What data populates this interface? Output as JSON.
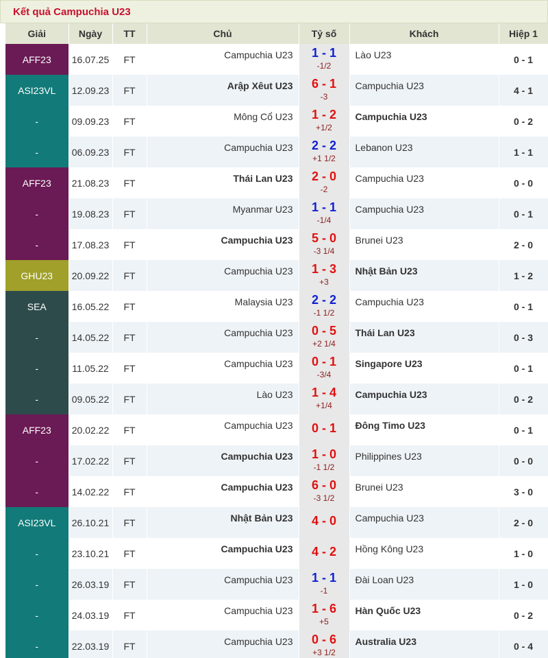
{
  "page": {
    "title": "Kết quả Campuchia U23"
  },
  "colors": {
    "title": "#c8102e",
    "home_win": "#e01010",
    "draw": "#1020d0"
  },
  "table": {
    "headers": {
      "league": "Giải",
      "date": "Ngày",
      "status": "TT",
      "home": "Chủ",
      "score": "Tỷ số",
      "away": "Khách",
      "ht": "Hiệp 1"
    },
    "rows": [
      {
        "league": "AFF23",
        "league_color": "#6a1a54",
        "date": "16.07.25",
        "status": "FT",
        "home": "Campuchia U23",
        "score": "1 - 1",
        "score_color": "blue",
        "handicap": "-1/2",
        "away": "Lào U23",
        "ht": "0 - 1",
        "winner": ""
      },
      {
        "league": "ASI23VL",
        "league_color": "#127a78",
        "date": "12.09.23",
        "status": "FT",
        "home": "Arập Xêut U23",
        "score": "6 - 1",
        "score_color": "red",
        "handicap": "-3",
        "away": "Campuchia U23",
        "ht": "4 - 1",
        "winner": "home"
      },
      {
        "league": "-",
        "league_color": "#127a78",
        "date": "09.09.23",
        "status": "FT",
        "home": "Mông Cổ U23",
        "score": "1 - 2",
        "score_color": "red",
        "handicap": "+1/2",
        "away": "Campuchia U23",
        "ht": "0 - 2",
        "winner": "away"
      },
      {
        "league": "-",
        "league_color": "#127a78",
        "date": "06.09.23",
        "status": "FT",
        "home": "Campuchia U23",
        "score": "2 - 2",
        "score_color": "blue",
        "handicap": "+1 1/2",
        "away": "Lebanon U23",
        "ht": "1 - 1",
        "winner": ""
      },
      {
        "league": "AFF23",
        "league_color": "#6a1a54",
        "date": "21.08.23",
        "status": "FT",
        "home": "Thái Lan U23",
        "score": "2 - 0",
        "score_color": "red",
        "handicap": "-2",
        "away": "Campuchia U23",
        "ht": "0 - 0",
        "winner": "home"
      },
      {
        "league": "-",
        "league_color": "#6a1a54",
        "date": "19.08.23",
        "status": "FT",
        "home": "Myanmar U23",
        "score": "1 - 1",
        "score_color": "blue",
        "handicap": "-1/4",
        "away": "Campuchia U23",
        "ht": "0 - 1",
        "winner": ""
      },
      {
        "league": "-",
        "league_color": "#6a1a54",
        "date": "17.08.23",
        "status": "FT",
        "home": "Campuchia U23",
        "score": "5 - 0",
        "score_color": "red",
        "handicap": "-3 1/4",
        "away": "Brunei U23",
        "ht": "2 - 0",
        "winner": "home"
      },
      {
        "league": "GHU23",
        "league_color": "#a0a02a",
        "date": "20.09.22",
        "status": "FT",
        "home": "Campuchia U23",
        "score": "1 - 3",
        "score_color": "red",
        "handicap": "+3",
        "away": "Nhật Bản U23",
        "ht": "1 - 2",
        "winner": "away"
      },
      {
        "league": "SEA",
        "league_color": "#2e4b4b",
        "date": "16.05.22",
        "status": "FT",
        "home": "Malaysia U23",
        "score": "2 - 2",
        "score_color": "blue",
        "handicap": "-1 1/2",
        "away": "Campuchia U23",
        "ht": "0 - 1",
        "winner": ""
      },
      {
        "league": "-",
        "league_color": "#2e4b4b",
        "date": "14.05.22",
        "status": "FT",
        "home": "Campuchia U23",
        "score": "0 - 5",
        "score_color": "red",
        "handicap": "+2 1/4",
        "away": "Thái Lan U23",
        "ht": "0 - 3",
        "winner": "away"
      },
      {
        "league": "-",
        "league_color": "#2e4b4b",
        "date": "11.05.22",
        "status": "FT",
        "home": "Campuchia U23",
        "score": "0 - 1",
        "score_color": "red",
        "handicap": "-3/4",
        "away": "Singapore U23",
        "ht": "0 - 1",
        "winner": "away"
      },
      {
        "league": "-",
        "league_color": "#2e4b4b",
        "date": "09.05.22",
        "status": "FT",
        "home": "Lào U23",
        "score": "1 - 4",
        "score_color": "red",
        "handicap": "+1/4",
        "away": "Campuchia U23",
        "ht": "0 - 2",
        "winner": "away"
      },
      {
        "league": "AFF23",
        "league_color": "#6a1a54",
        "date": "20.02.22",
        "status": "FT",
        "home": "Campuchia U23",
        "score": "0 - 1",
        "score_color": "red",
        "handicap": "",
        "away": "Đông Timo U23",
        "ht": "0 - 1",
        "winner": "away"
      },
      {
        "league": "-",
        "league_color": "#6a1a54",
        "date": "17.02.22",
        "status": "FT",
        "home": "Campuchia U23",
        "score": "1 - 0",
        "score_color": "red",
        "handicap": "-1 1/2",
        "away": "Philippines U23",
        "ht": "0 - 0",
        "winner": "home"
      },
      {
        "league": "-",
        "league_color": "#6a1a54",
        "date": "14.02.22",
        "status": "FT",
        "home": "Campuchia U23",
        "score": "6 - 0",
        "score_color": "red",
        "handicap": "-3 1/2",
        "away": "Brunei U23",
        "ht": "3 - 0",
        "winner": "home"
      },
      {
        "league": "ASI23VL",
        "league_color": "#127a78",
        "date": "26.10.21",
        "status": "FT",
        "home": "Nhật Bản U23",
        "score": "4 - 0",
        "score_color": "red",
        "handicap": "",
        "away": "Campuchia U23",
        "ht": "2 - 0",
        "winner": "home"
      },
      {
        "league": "-",
        "league_color": "#127a78",
        "date": "23.10.21",
        "status": "FT",
        "home": "Campuchia U23",
        "score": "4 - 2",
        "score_color": "red",
        "handicap": "",
        "away": "Hồng Kông U23",
        "ht": "1 - 0",
        "winner": "home"
      },
      {
        "league": "-",
        "league_color": "#127a78",
        "date": "26.03.19",
        "status": "FT",
        "home": "Campuchia U23",
        "score": "1 - 1",
        "score_color": "blue",
        "handicap": "-1",
        "away": "Đài Loan U23",
        "ht": "1 - 0",
        "winner": ""
      },
      {
        "league": "-",
        "league_color": "#127a78",
        "date": "24.03.19",
        "status": "FT",
        "home": "Campuchia U23",
        "score": "1 - 6",
        "score_color": "red",
        "handicap": "+5",
        "away": "Hàn Quốc U23",
        "ht": "0 - 2",
        "winner": "away"
      },
      {
        "league": "-",
        "league_color": "#127a78",
        "date": "22.03.19",
        "status": "FT",
        "home": "Campuchia U23",
        "score": "0 - 6",
        "score_color": "red",
        "handicap": "+3 1/2",
        "away": "Australia U23",
        "ht": "0 - 4",
        "winner": "away"
      }
    ]
  }
}
